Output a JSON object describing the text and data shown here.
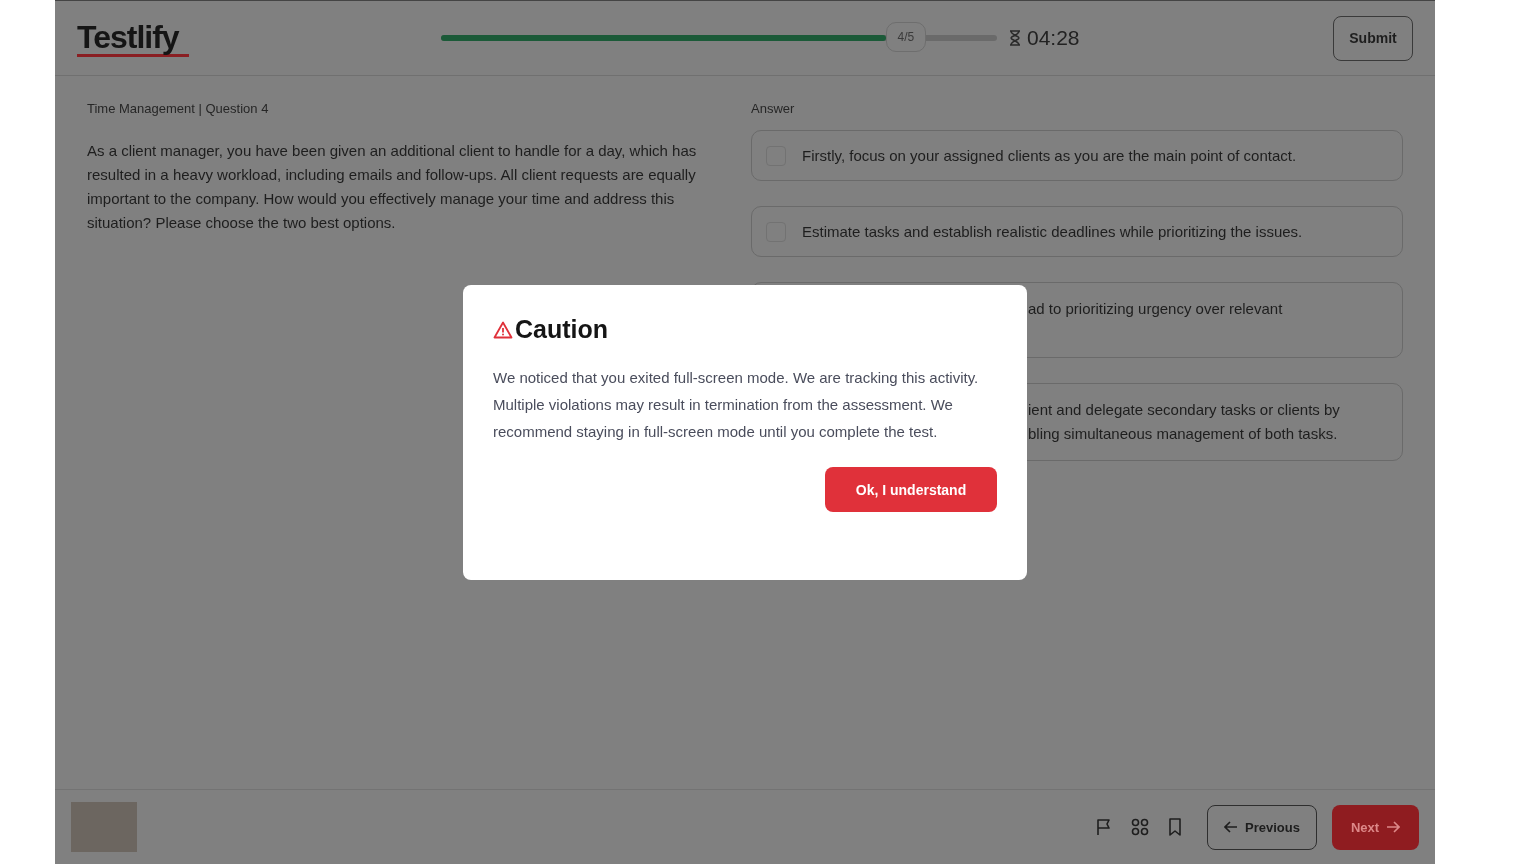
{
  "header": {
    "logo": "Testlify",
    "progress": {
      "level": 0.8,
      "label": "4/5"
    },
    "timer": "04:28",
    "submit": "Submit"
  },
  "question": {
    "meta": "Time Management | Question 4",
    "text": "As a client manager, you have been given an additional client to handle for a day, which has resulted in a heavy workload, including emails and follow-ups. All client requests are equally important to the company. How would you effectively manage your time and address this situation? Please choose the two best options."
  },
  "answer": {
    "label": "Answer",
    "options": [
      {
        "kind": "full",
        "text": "Firstly, focus on your assigned clients as you are the main point of contact.",
        "checked": false
      },
      {
        "kind": "full",
        "text": "Estimate tasks and establish realistic deadlines while prioritizing the issues.",
        "checked": false
      },
      {
        "kind": "partial",
        "lines": [
          "ad to prioritizing urgency over relevant"
        ]
      },
      {
        "kind": "partial",
        "lines": [
          "ient and delegate secondary tasks or clients by",
          "bling simultaneous management of both tasks."
        ]
      }
    ]
  },
  "dialog": {
    "title": "Caution",
    "message": "We noticed that you exited full-screen mode. We are tracking this activity. Multiple violations may result in termination from the assessment. We recommend staying in full-screen mode until you complete the test.",
    "button": "Ok, I understand"
  },
  "footer": {
    "previous": "Previous",
    "next": "Next"
  }
}
